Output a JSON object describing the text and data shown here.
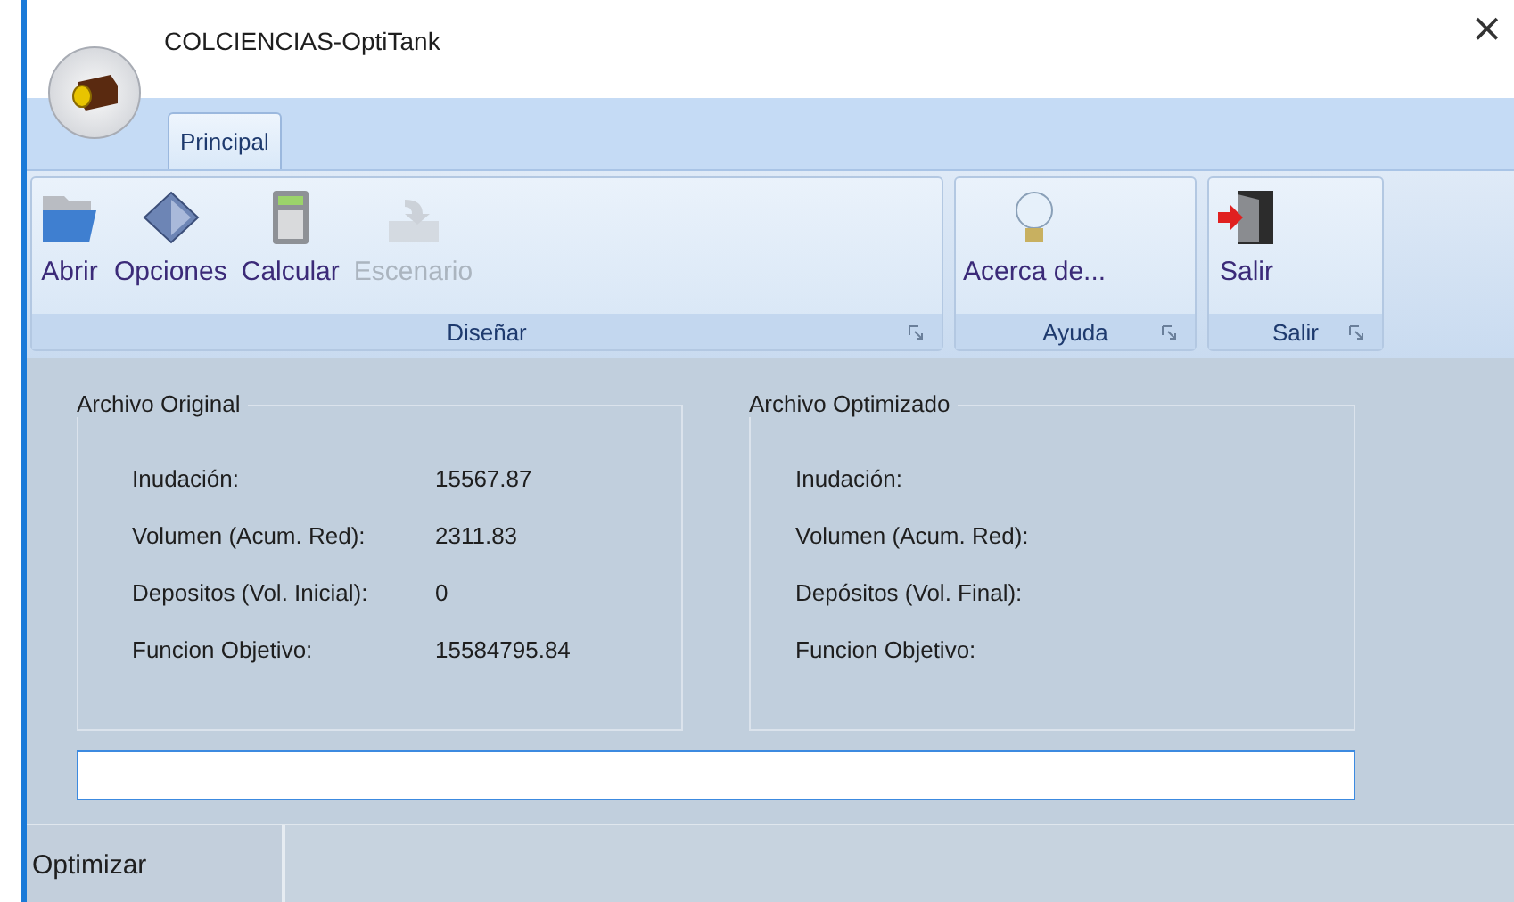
{
  "window": {
    "title": "COLCIENCIAS-OptiTank",
    "close": "×"
  },
  "tabs": [
    {
      "label": "Principal",
      "selected": true
    }
  ],
  "ribbon_groups": [
    {
      "label": "Diseñar",
      "buttons": [
        {
          "label": "Abrir",
          "kind": "folder",
          "disabled": false
        },
        {
          "label": "Opciones",
          "kind": "diamond",
          "disabled": false
        },
        {
          "label": "Calcular",
          "kind": "calculator",
          "disabled": false
        },
        {
          "label": "Escenario",
          "kind": "tray",
          "disabled": true
        }
      ]
    },
    {
      "label": "Ayuda",
      "buttons": [
        {
          "label": "Acerca de...",
          "kind": "bulb",
          "disabled": false
        }
      ]
    },
    {
      "label": "Salir",
      "buttons": [
        {
          "label": "Salir",
          "kind": "door",
          "disabled": false
        }
      ]
    }
  ],
  "groups": [
    {
      "title": "Archivo Original",
      "rows": [
        {
          "label": "Inudación:",
          "value": "15567.87"
        },
        {
          "label": "Volumen (Acum. Red):",
          "value": "2311.83"
        },
        {
          "label": "Depositos (Vol. Inicial):",
          "value": "0"
        },
        {
          "label": "Funcion Objetivo:",
          "value": "15584795.84"
        }
      ]
    },
    {
      "title": "Archivo Optimizado",
      "rows": [
        {
          "label": "Inudación:"
        },
        {
          "label": "Volumen (Acum. Red):"
        },
        {
          "label": "Depósitos (Vol. Final):"
        },
        {
          "label": "Funcion Objetivo:"
        }
      ]
    }
  ],
  "status_bar": {
    "text": "Optimizar"
  }
}
